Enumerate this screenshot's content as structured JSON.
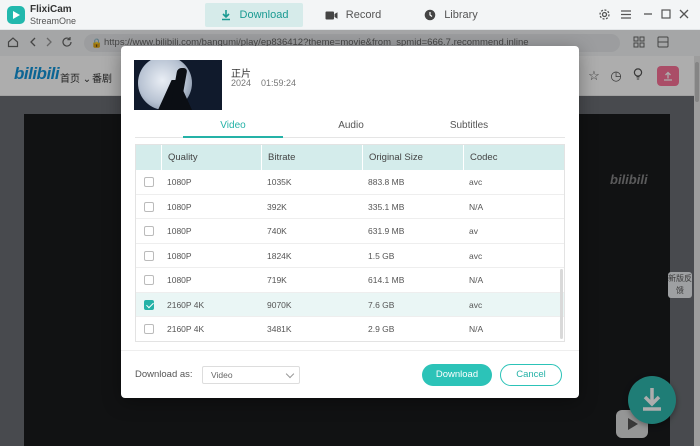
{
  "app": {
    "name": "FlixiCam",
    "subtitle": "StreamOne",
    "accent": "#25b2a7"
  },
  "nav": {
    "tabs": [
      {
        "label": "Download",
        "icon": "download-icon"
      },
      {
        "label": "Record",
        "icon": "record-icon"
      },
      {
        "label": "Library",
        "icon": "library-icon"
      }
    ]
  },
  "browser": {
    "url": "https://www.bilibili.com/bangumi/play/ep836412?theme=movie&from_spmid=666.7.recommend.inline"
  },
  "site": {
    "logo": "bilibili",
    "nav_home": "首页",
    "nav_fan": "番剧",
    "side_tab": "新版反馈",
    "watermark": "bilibili"
  },
  "modal": {
    "title": "正片",
    "year": "2024",
    "duration": "01:59:24",
    "tabs": [
      "Video",
      "Audio",
      "Subtitles"
    ],
    "active_tab": "Video",
    "columns": [
      "Quality",
      "Bitrate",
      "Original Size",
      "Codec"
    ],
    "rows": [
      {
        "checked": false,
        "quality": "1080P",
        "bitrate": "1035K",
        "size": "883.8 MB",
        "codec": "avc"
      },
      {
        "checked": false,
        "quality": "1080P",
        "bitrate": "392K",
        "size": "335.1 MB",
        "codec": "N/A"
      },
      {
        "checked": false,
        "quality": "1080P",
        "bitrate": "740K",
        "size": "631.9 MB",
        "codec": "av"
      },
      {
        "checked": false,
        "quality": "1080P",
        "bitrate": "1824K",
        "size": "1.5 GB",
        "codec": "avc"
      },
      {
        "checked": false,
        "quality": "1080P",
        "bitrate": "719K",
        "size": "614.1 MB",
        "codec": "N/A"
      },
      {
        "checked": true,
        "quality": "2160P 4K",
        "bitrate": "9070K",
        "size": "7.6 GB",
        "codec": "avc"
      },
      {
        "checked": false,
        "quality": "2160P 4K",
        "bitrate": "3481K",
        "size": "2.9 GB",
        "codec": "N/A"
      }
    ],
    "download_as_label": "Download as:",
    "download_as_value": "Video",
    "download_button": "Download",
    "cancel_button": "Cancel"
  }
}
